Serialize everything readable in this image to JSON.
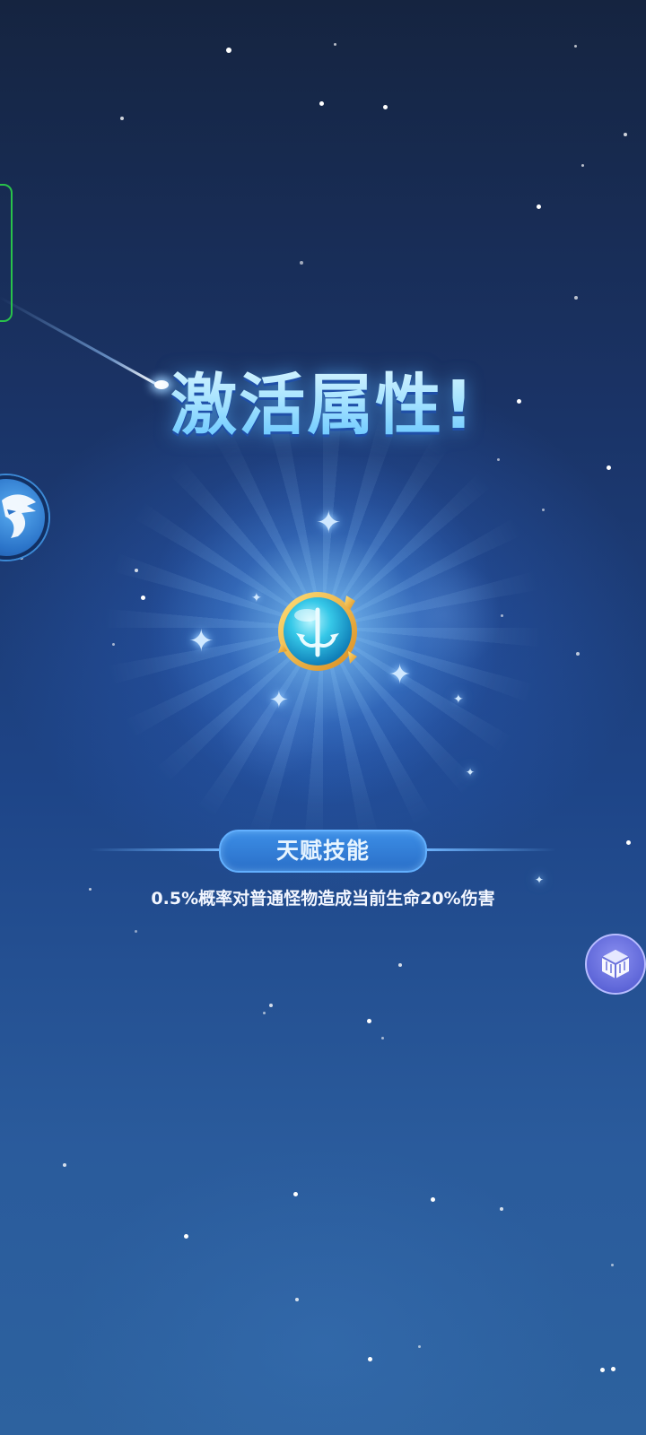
{
  "title": "激活属性!",
  "talent": {
    "banner_label": "天赋技能",
    "description": "0.5%概率对普通怪物造成当前生命20%伤害"
  },
  "icons": {
    "side_panel": "panel-outline",
    "left_button": "shark-icon",
    "center_gem": "trident-gem-icon",
    "right_button": "cube-icon"
  },
  "colors": {
    "title_gradient_top": "#e8fbff",
    "title_gradient_bottom": "#5fc3ff",
    "banner_fill": "#3c8ee6",
    "banner_border": "#62b0ff",
    "side_panel_border": "#29c24a",
    "gem_cyan": "#36c8e8",
    "gem_gold": "#f2b43a"
  }
}
